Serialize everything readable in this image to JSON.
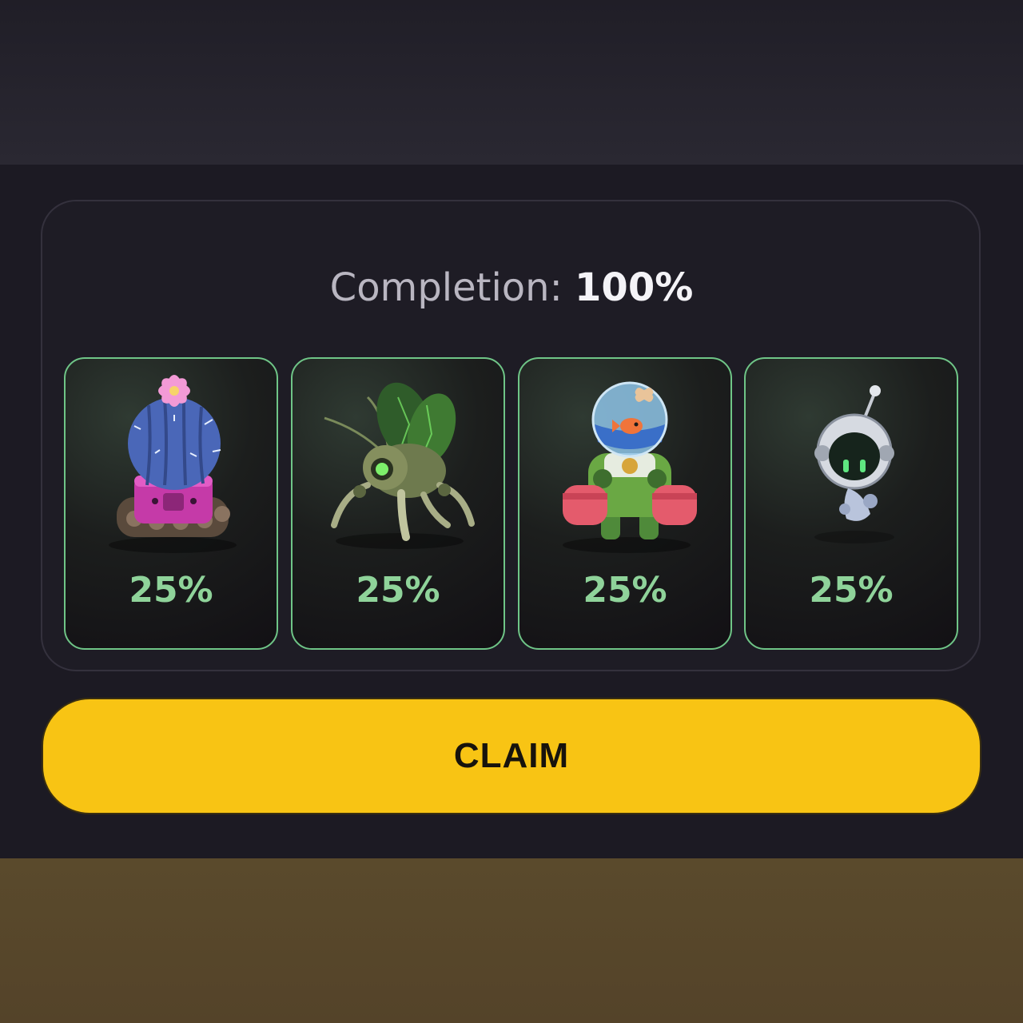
{
  "completion": {
    "label": "Completion:",
    "value": "100%"
  },
  "cards": [
    {
      "name": "cactus-tank-robot",
      "icon": "cactus-robot-icon",
      "percent": "25%"
    },
    {
      "name": "insect-drone-robot",
      "icon": "insect-robot-icon",
      "percent": "25%"
    },
    {
      "name": "fishbowl-mech-robot",
      "icon": "fishbowl-robot-icon",
      "percent": "25%"
    },
    {
      "name": "floating-orb-robot",
      "icon": "orb-robot-icon",
      "percent": "25%"
    }
  ],
  "claim_button": {
    "label": "CLAIM"
  },
  "colors": {
    "accent_green": "#8fd39a",
    "card_border": "#6fc587",
    "claim_yellow": "#f8c414",
    "background": "#1c1a23"
  }
}
